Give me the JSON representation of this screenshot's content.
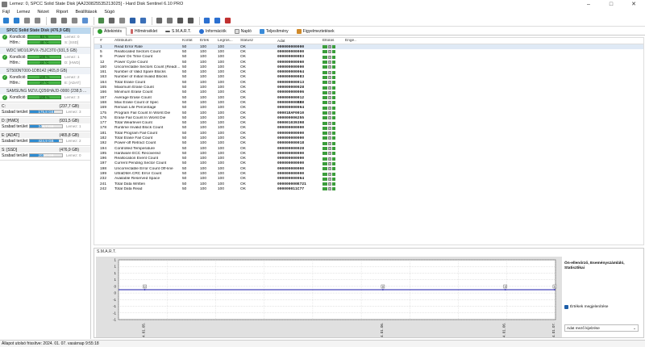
{
  "window": {
    "title": "Lemez: 0, SPCC Solid State Disk [AA230825535213025] - Hard Disk Sentinel 6.10 PRO",
    "minimize": "–",
    "maximize": "□",
    "close": "✕"
  },
  "menu": [
    "Fájl",
    "Lemez",
    "Nézet",
    "Riport",
    "Beállítások",
    "Súgó"
  ],
  "toolbar_icons": [
    "refresh-icon",
    "refresh-all-icon",
    "disk-icon",
    "disk2-icon",
    "tools-icon",
    "wrench-icon",
    "sound-icon",
    "info-doc-icon",
    "report-icon",
    "printer-icon",
    "send-icon",
    "save-icon",
    "chart-icon",
    "document-icon",
    "options-icon",
    "camera-icon",
    "settings-icon",
    "help-icon",
    "info-icon",
    "power-icon"
  ],
  "disks": [
    {
      "name": "SPCC Solid State Disk (476,9 GB)",
      "health_label": "Kondíció:",
      "health": "84 %",
      "health_pct": 84,
      "health_extra": "Lemez: 0",
      "temp_label": "Hőm.:",
      "temp": "40 °C",
      "temp_pct": 40,
      "temp_extra": "S: [SSD]",
      "selected": true
    },
    {
      "name": "WDC WD10JPVX-75JC3T0 (931,5 GB)",
      "health_label": "Kondíció:",
      "health": "100 %",
      "health_pct": 100,
      "health_extra": "Lemez: 1",
      "temp_label": "Hőm.:",
      "temp": "23 °C",
      "temp_pct": 23,
      "temp_extra": "D: [HWD]",
      "selected": false
    },
    {
      "name": "ST500NT000-1DB142 (465,8 GB)",
      "health_label": "Kondíció:",
      "health": "100 %",
      "health_pct": 100,
      "health_extra": "Lemez: 2",
      "temp_label": "Hőm.:",
      "temp": "27 °C",
      "temp_pct": 27,
      "temp_extra": "E: [ADAT]",
      "selected": false
    },
    {
      "name": "SAMSUNG MZVLQ256HAJD-0000 (238,5 ...",
      "health_label": "Kondíció:",
      "health": "100 %",
      "health_pct": 100,
      "health_extra": "Lemez: 3",
      "selected": false
    }
  ],
  "volumes": [
    {
      "name": "C:",
      "size": "(237,7 GB)",
      "free_label": "Szabad terület",
      "free": "175,8 GB",
      "free_pct": 74,
      "extra": "Lemez: 3"
    },
    {
      "name": "D: [HWD]",
      "size": "(931,5 GB)",
      "free_label": "Szabad terület",
      "free": "346,7 GB",
      "free_pct": 37,
      "extra": "Lemez: 1"
    },
    {
      "name": "E: [ADAT]",
      "size": "(465,8 GB)",
      "free_label": "Szabad terület",
      "free": "424,9 GB",
      "free_pct": 91,
      "extra": "Lemez: 2"
    },
    {
      "name": "S: [SSD]",
      "size": "(476,9 GB)",
      "free_label": "Szabad terület",
      "free": "203,0 GB",
      "free_pct": 43,
      "extra": "Lemez: 0"
    }
  ],
  "tabs": [
    "Áttekintés",
    "Hőmérséklet",
    "S.M.A.R.T.",
    "Információk",
    "Napló",
    "Teljesítmény",
    "Figyelmeztetések"
  ],
  "smart_table": {
    "headers": [
      "#",
      "Attribútum",
      "Korlát",
      "Érték",
      "Legros...",
      "Státusz",
      "Adat",
      "Eltolás",
      "Enge..."
    ],
    "rows": [
      [
        "1",
        "Read Error Rate",
        "50",
        "100",
        "100",
        "OK",
        "000000000000"
      ],
      [
        "5",
        "Reallocated Sectors Count",
        "50",
        "100",
        "100",
        "OK",
        "000000000000"
      ],
      [
        "9",
        "Power On Time Count",
        "50",
        "100",
        "100",
        "OK",
        "0000000000D3"
      ],
      [
        "12",
        "Power Cycle Count",
        "50",
        "100",
        "100",
        "OK",
        "000000000060"
      ],
      [
        "160",
        "Uncorrectable Sectors Count (Read/...",
        "50",
        "100",
        "100",
        "OK",
        "000000000000"
      ],
      [
        "161",
        "Number of Valid Spare Blocks",
        "50",
        "100",
        "100",
        "OK",
        "000000000064"
      ],
      [
        "163",
        "Number of Initial Invalid Blocks",
        "50",
        "100",
        "100",
        "OK",
        "000000000083"
      ],
      [
        "164",
        "Total Erase Count",
        "50",
        "100",
        "100",
        "OK",
        "000000000013"
      ],
      [
        "165",
        "Maximum Erase Count",
        "50",
        "100",
        "100",
        "OK",
        "000000000028"
      ],
      [
        "166",
        "Minimum Erase Count",
        "50",
        "100",
        "100",
        "OK",
        "000000000006"
      ],
      [
        "167",
        "Average Erase Count",
        "50",
        "100",
        "100",
        "OK",
        "000000000012"
      ],
      [
        "168",
        "Max Erase Count of Spec",
        "50",
        "100",
        "100",
        "OK",
        "000000000BB8"
      ],
      [
        "169",
        "Remain Life Percentage",
        "50",
        "100",
        "100",
        "OK",
        "000000000064"
      ],
      [
        "175",
        "Program Fail Count In Worst Die",
        "50",
        "100",
        "100",
        "OK",
        "00001EAF0010"
      ],
      [
        "176",
        "Erase Fail Count In Worst Die",
        "50",
        "100",
        "100",
        "OK",
        "000000006255"
      ],
      [
        "177",
        "Total Wearlevel Count",
        "50",
        "100",
        "100",
        "OK",
        "000001039398"
      ],
      [
        "178",
        "Runtime Invalid Block Count",
        "50",
        "100",
        "100",
        "OK",
        "000000000000"
      ],
      [
        "181",
        "Total Program Fail Count",
        "50",
        "100",
        "100",
        "OK",
        "000000000000"
      ],
      [
        "182",
        "Total Erase Fail Count",
        "50",
        "100",
        "100",
        "OK",
        "000000000000"
      ],
      [
        "192",
        "Power-off Retract Count",
        "50",
        "100",
        "100",
        "OK",
        "000000000018"
      ],
      [
        "194",
        "Controlled Temperature",
        "50",
        "100",
        "100",
        "OK",
        "000000000028"
      ],
      [
        "195",
        "Hardware ECC Recovered",
        "50",
        "100",
        "100",
        "OK",
        "000000000000"
      ],
      [
        "196",
        "Reallocation Event Count",
        "50",
        "100",
        "100",
        "OK",
        "000000000000"
      ],
      [
        "197",
        "Current Pending Sector Count",
        "50",
        "100",
        "100",
        "OK",
        "000000000000"
      ],
      [
        "198",
        "Uncorrectable Error Count Off-line",
        "50",
        "100",
        "100",
        "OK",
        "000000000000"
      ],
      [
        "199",
        "UltraDMA CRC Error Count",
        "50",
        "100",
        "100",
        "OK",
        "000000000000"
      ],
      [
        "232",
        "Available Reserved Space",
        "50",
        "100",
        "100",
        "OK",
        "000000000064"
      ],
      [
        "241",
        "Total Data Written",
        "50",
        "100",
        "100",
        "OK",
        "000000000E721"
      ],
      [
        "242",
        "Total Data Read",
        "50",
        "100",
        "100",
        "OK",
        "000000011C77"
      ]
    ],
    "offset_value": "0"
  },
  "smart_section_title": "S.M.A.R.T.",
  "chart_data": {
    "type": "line",
    "x": [
      "2024. 01. 05.",
      "2024. 01. 06.",
      "2024. 01. 06.",
      "2024. 01. 07."
    ],
    "series": [
      {
        "values": [
          0,
          0,
          0,
          0
        ]
      }
    ],
    "point_labels": [
      "0",
      "0",
      "0",
      "0"
    ],
    "ylabels": [
      "1",
      "1",
      "1",
      "1",
      "0",
      "0",
      "-1",
      "-1",
      "-1",
      "-1"
    ],
    "grid": true,
    "color": "#1a1aa8"
  },
  "right_panel": {
    "title": "Ön-ellenőrző, Eseményszámláló, Statisztikai",
    "show_values_label": "Értékek megjelenítése",
    "dropdown_value": "Adat mező kijelzése",
    "dropdown_arrow": "⌄"
  },
  "status_text": "Állapot utolsó frissítve: 2024. 01. 07. vasárnap 9:55:18"
}
